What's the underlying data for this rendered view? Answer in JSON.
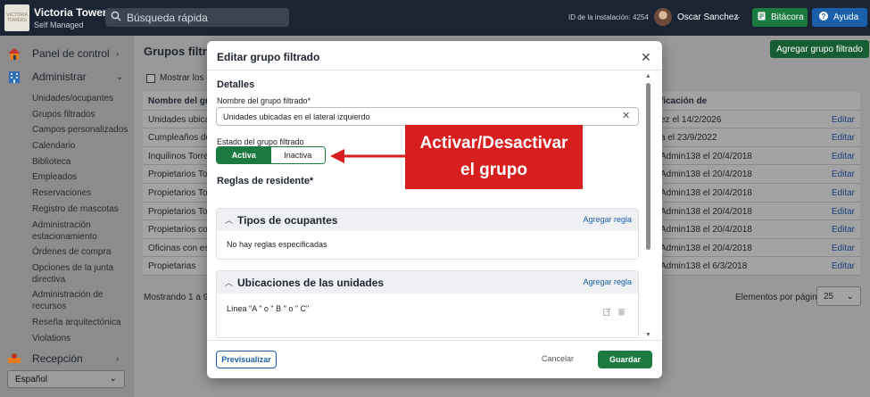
{
  "topbar": {
    "logo_text": "VICTORIA TOWERS",
    "app_name": "Victoria Towers",
    "app_sub": "Self Managed",
    "search_placeholder": "Búsqueda rápida",
    "install_id": "ID de la instalación: 4254",
    "user_name": "Oscar Sanchez",
    "bitacora_label": "Bitácora",
    "ayuda_label": "Ayuda",
    "colors": {
      "bar": "#1a2433",
      "bitacora": "#1a7a3f",
      "ayuda": "#1b5fab"
    }
  },
  "sidebar": {
    "main_items": [
      {
        "label": "Panel de control",
        "icon": "home-icon"
      },
      {
        "label": "Administrar",
        "icon": "building-icon"
      },
      {
        "label": "Recepción",
        "icon": "reception-icon"
      }
    ],
    "sub_items": [
      "Unidades/ocupantes",
      "Grupos filtrados",
      "Campos personalizados",
      "Calendario",
      "Biblioteca",
      "Empleados",
      "Reservaciones",
      "Registro de mascotas",
      "Administración estacionamiento",
      "Órdenes de compra",
      "Opciones de la junta directiva",
      "Administración de recursos",
      "Reseña arquitectónica",
      "Violations"
    ],
    "language": "Español"
  },
  "main": {
    "title": "Grupos filtrados",
    "add_button": "Agregar grupo filtrado",
    "show_inactive": "Mostrar los ina",
    "table": {
      "headers": [
        "Nombre del grup",
        "ficación de",
        ""
      ],
      "rows": [
        [
          "Unidades ubicad",
          "ez el 14/2/2026",
          "Editar"
        ],
        [
          "Cumpleaños de S",
          "a el 23/9/2022",
          "Editar"
        ],
        [
          "Inquilinos Torre 1",
          "Admin138 el 20/4/2018",
          "Editar"
        ],
        [
          "Propietarios Torr",
          "Admin138 el 20/4/2018",
          "Editar"
        ],
        [
          "Propietarios Torr",
          "Admin138 el 20/4/2018",
          "Editar"
        ],
        [
          "Propietarios Torr",
          "Admin138 el 20/4/2018",
          "Editar"
        ],
        [
          "Propietarios con",
          "Admin138 el 20/4/2018",
          "Editar"
        ],
        [
          "Oficinas con esta",
          "Admin138 el 20/4/2018",
          "Editar"
        ],
        [
          "Propietarias",
          "Admin138 el 6/3/2018",
          "Editar"
        ]
      ]
    },
    "paging_text": "Mostrando 1 a 9 d",
    "per_page_label": "Elementos por página",
    "per_page_value": "25"
  },
  "modal": {
    "title": "Editar grupo filtrado",
    "details_heading": "Detalles",
    "name_label": "Nombre del grupo filtrado*",
    "name_value": "Unidades ubicadas en el lateral izquierdo",
    "state_label": "Estado del grupo filtrado",
    "state_active": "Activa",
    "state_inactive": "Inactiva",
    "state_selected": "Activa",
    "rules_heading": "Reglas de residente*",
    "cards": [
      {
        "title": "Tipos de ocupantes",
        "add": "Agregar regla",
        "content": "No hay reglas especificadas"
      },
      {
        "title": "Ubicaciones de las unidades",
        "add": "Agregar regla",
        "content": "Línea \"A \" o \" B \" o \" C\""
      }
    ],
    "preview_button": "Previsualizar",
    "cancel_button": "Cancelar",
    "save_button": "Guardar"
  },
  "annotation": {
    "line1": "Activar/Desactivar",
    "line2": "el grupo",
    "color": "#d81f1f"
  }
}
